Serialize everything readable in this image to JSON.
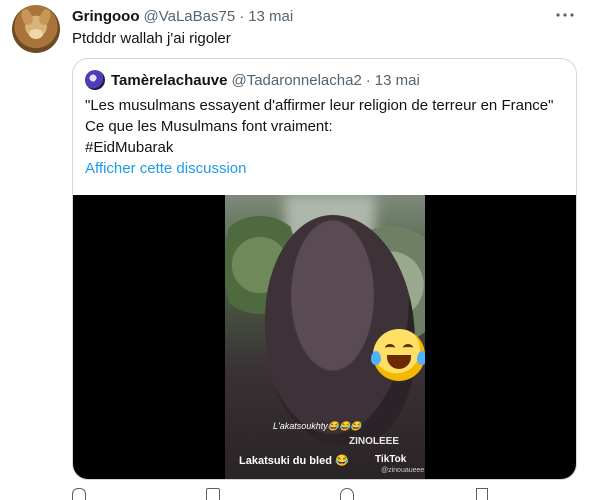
{
  "tweet": {
    "display_name": "Gringooo",
    "handle": "@VaLaBas75",
    "separator": "·",
    "date": "13 mai",
    "text": "Ptdddr wallah j'ai rigoler"
  },
  "quoted": {
    "display_name": "Tamèrelachauve",
    "handle": "@Tadaronnelacha2",
    "separator": "·",
    "date": "13 mai",
    "lines": [
      "\"Les musulmans essayent d'affirmer leur religion de terreur en France\"",
      "Ce que les Musulmans font vraiment:",
      "#EidMubarak"
    ],
    "show_thread": "Afficher cette discussion",
    "video": {
      "caption_top": "L'akatsoukhty😂😂😂",
      "watermark": "ZINOLEEE",
      "caption_bottom": "Lakatsuki du bled 😂",
      "platform": "TikTok",
      "platform_handle": "@zinouaueee"
    }
  },
  "icons": {
    "more": "more-icon",
    "laughing_emoji": "face-with-tears-of-joy-icon",
    "reply": "reply-icon",
    "retweet": "retweet-icon",
    "like": "like-icon",
    "share": "share-icon"
  }
}
